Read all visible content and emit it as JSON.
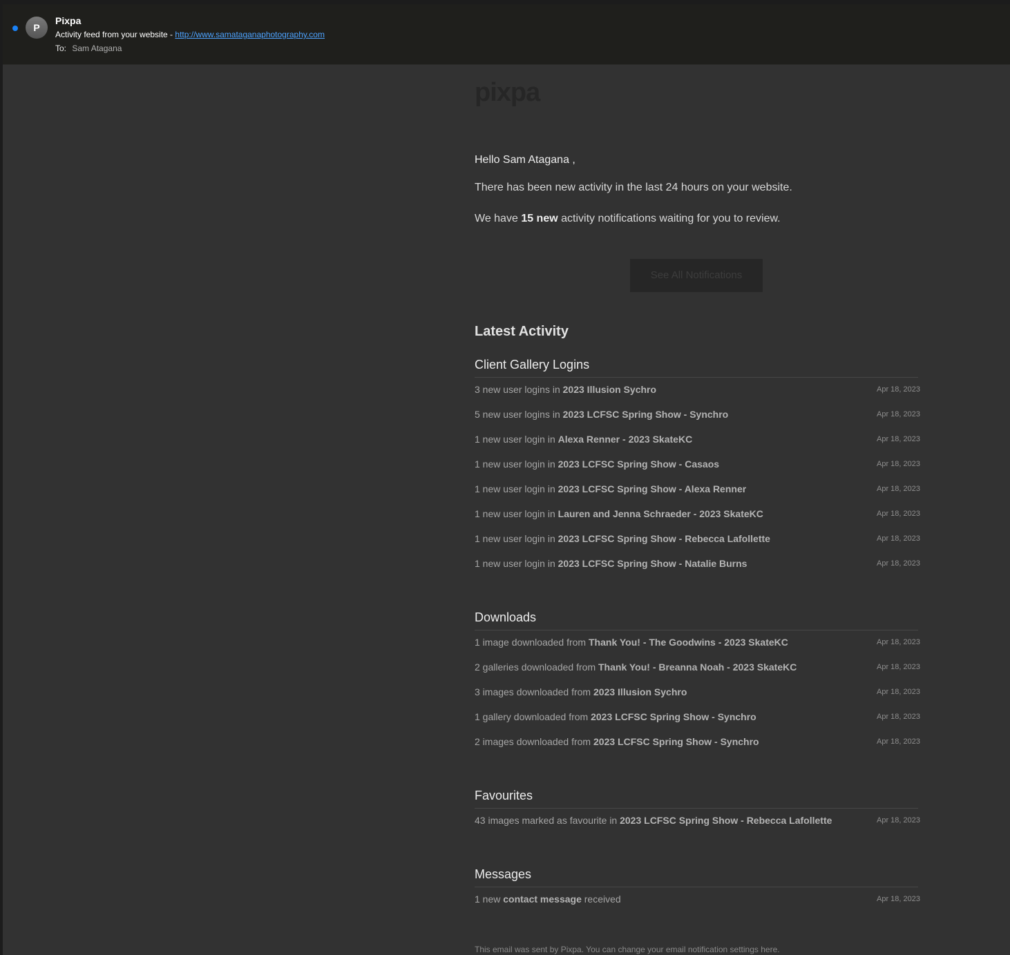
{
  "header": {
    "avatar_letter": "P",
    "sender": "Pixpa",
    "subject_prefix": "Activity feed from your website -",
    "subject_link": "http://www.samataganaphotography.com",
    "to_label": "To:",
    "to_name": "Sam Atagana"
  },
  "email": {
    "logo": "pixpa",
    "greeting": "Hello Sam Atagana ,",
    "intro": "There has been new activity in the last 24 hours on your website.",
    "count_prefix": "We have",
    "count_bold": "15 new",
    "count_suffix": "activity notifications waiting for you to review.",
    "cta_label": "See All Notifications",
    "latest_heading": "Latest Activity",
    "footer": "This email was sent by Pixpa. You can change your email notification settings here."
  },
  "sections": [
    {
      "title": "Client Gallery Logins",
      "rows": [
        {
          "pre": "3 new user logins in",
          "bold": "2023 Illusion Sychro",
          "post": "",
          "date": "Apr 18, 2023"
        },
        {
          "pre": "5 new user logins in",
          "bold": "2023 LCFSC Spring Show - Synchro",
          "post": "",
          "date": "Apr 18, 2023"
        },
        {
          "pre": "1 new user login in",
          "bold": "Alexa Renner - 2023 SkateKC",
          "post": "",
          "date": "Apr 18, 2023"
        },
        {
          "pre": "1 new user login in",
          "bold": "2023 LCFSC Spring Show - Casaos",
          "post": "",
          "date": "Apr 18, 2023"
        },
        {
          "pre": "1 new user login in",
          "bold": "2023 LCFSC Spring Show - Alexa Renner",
          "post": "",
          "date": "Apr 18, 2023"
        },
        {
          "pre": "1 new user login in",
          "bold": "Lauren and Jenna Schraeder - 2023 SkateKC",
          "post": "",
          "date": "Apr 18, 2023"
        },
        {
          "pre": "1 new user login in",
          "bold": "2023 LCFSC Spring Show - Rebecca Lafollette",
          "post": "",
          "date": "Apr 18, 2023"
        },
        {
          "pre": "1 new user login in",
          "bold": "2023 LCFSC Spring Show - Natalie Burns",
          "post": "",
          "date": "Apr 18, 2023"
        }
      ]
    },
    {
      "title": "Downloads",
      "rows": [
        {
          "pre": "1 image downloaded from",
          "bold": "Thank You! - The Goodwins - 2023 SkateKC",
          "post": "",
          "date": "Apr 18, 2023"
        },
        {
          "pre": "2 galleries downloaded from",
          "bold": "Thank You! - Breanna Noah - 2023 SkateKC",
          "post": "",
          "date": "Apr 18, 2023"
        },
        {
          "pre": "3 images downloaded from",
          "bold": "2023 Illusion Sychro",
          "post": "",
          "date": "Apr 18, 2023"
        },
        {
          "pre": "1 gallery downloaded from",
          "bold": "2023 LCFSC Spring Show - Synchro",
          "post": "",
          "date": "Apr 18, 2023"
        },
        {
          "pre": "2 images downloaded from",
          "bold": "2023 LCFSC Spring Show - Synchro",
          "post": "",
          "date": "Apr 18, 2023"
        }
      ]
    },
    {
      "title": "Favourites",
      "rows": [
        {
          "pre": "43 images marked as favourite in",
          "bold": "2023 LCFSC Spring Show - Rebecca Lafollette",
          "post": "",
          "date": "Apr 18, 2023"
        }
      ]
    },
    {
      "title": "Messages",
      "rows": [
        {
          "pre": "1 new",
          "bold": "contact message",
          "post": "received",
          "date": "Apr 18, 2023"
        }
      ]
    }
  ]
}
